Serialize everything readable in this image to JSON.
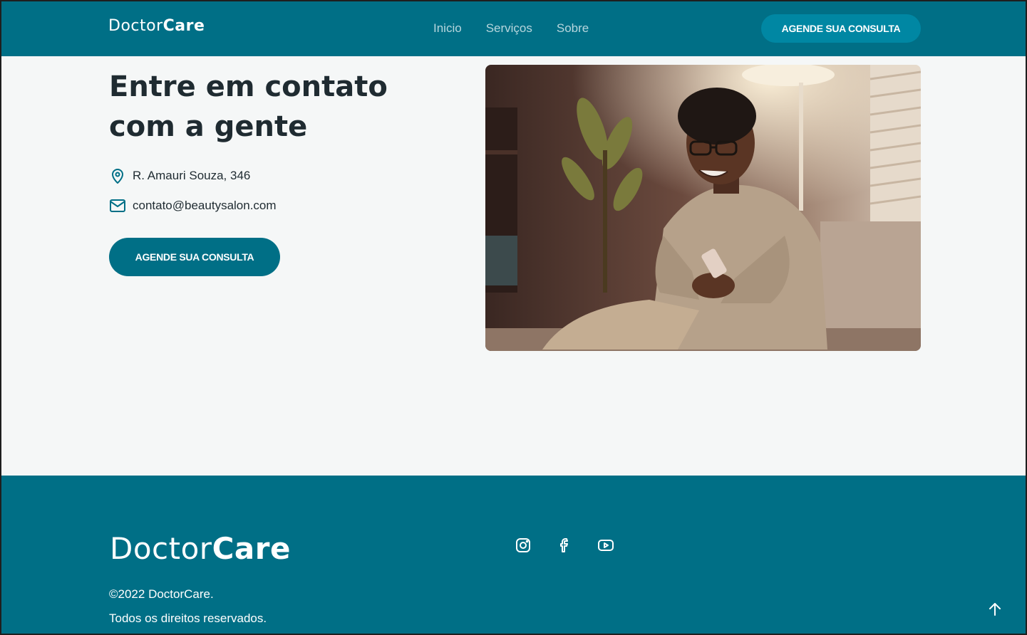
{
  "header": {
    "logo_regular": "Doctor",
    "logo_bold": "Care",
    "nav": [
      {
        "label": "Inicio"
      },
      {
        "label": "Serviços"
      },
      {
        "label": "Sobre"
      }
    ],
    "cta_label": "AGENDE SUA CONSULTA"
  },
  "contact": {
    "heading": "Entre em contato com a gente",
    "address": "R. Amauri Souza, 346",
    "email": "contato@beautysalon.com",
    "cta_label": "AGENDE SUA CONSULTA",
    "photo": "man-smiling-with-phone-photo"
  },
  "footer": {
    "logo_regular": "Doctor",
    "logo_bold": "Care",
    "copyright": "©2022 DoctorCare.",
    "rights": "Todos os direitos reservados.",
    "socials": [
      "instagram-icon",
      "facebook-icon",
      "youtube-icon"
    ],
    "back_to_top": "arrow-up-icon"
  },
  "colors": {
    "primary": "#006f86",
    "accent": "#0087a3",
    "background": "#f5f7f7",
    "text": "#1f2b31"
  }
}
